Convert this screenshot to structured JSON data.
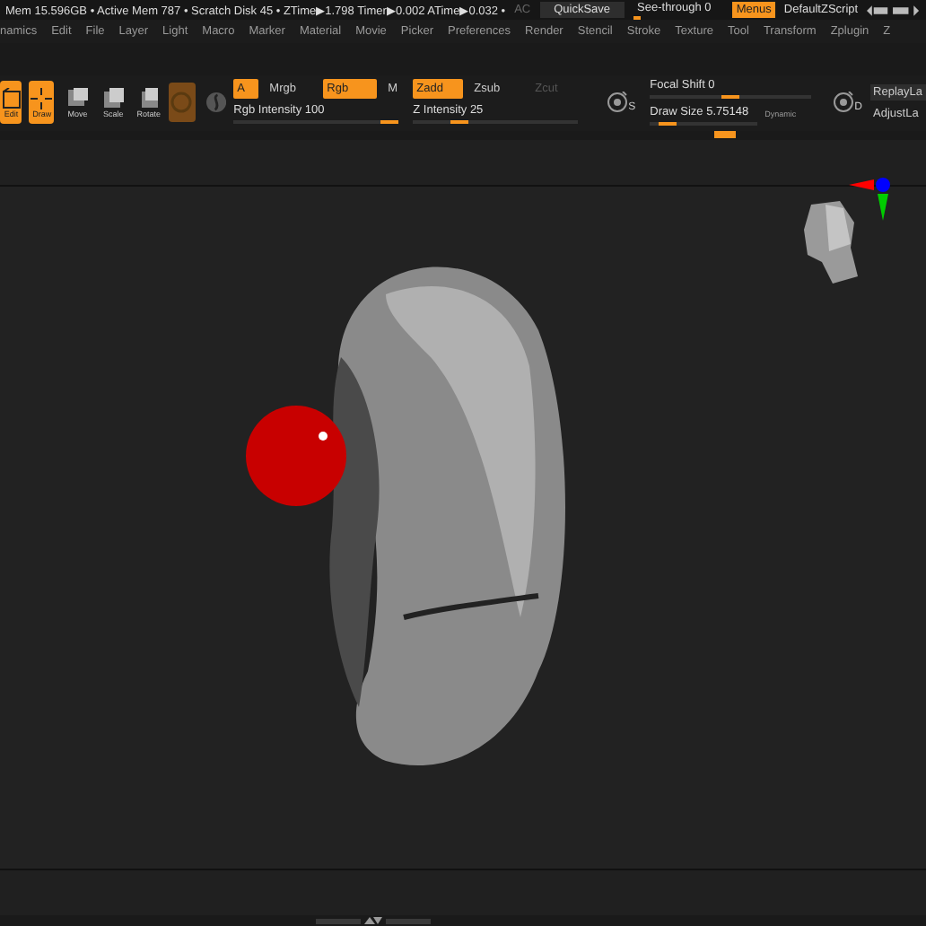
{
  "info_bar": {
    "stats": "Mem 15.596GB • Active Mem 787 • Scratch Disk 45 • ZTime▶1.798 Timer▶0.002 ATime▶0.032 •",
    "ac": "AC",
    "quicksave": "QuickSave",
    "see_through": {
      "label": "See-through  0",
      "level": 0.05
    },
    "menus": {
      "label": "Menus",
      "on": true
    },
    "script": "DefaultZScript"
  },
  "menu_bar": [
    "namics",
    "Edit",
    "File",
    "Layer",
    "Light",
    "Macro",
    "Marker",
    "Material",
    "Movie",
    "Picker",
    "Preferences",
    "Render",
    "Stencil",
    "Stroke",
    "Texture",
    "Tool",
    "Transform",
    "Zplugin",
    "Z"
  ],
  "toolbar": {
    "tools": [
      {
        "label": "Edit",
        "selected": true
      },
      {
        "label": "Draw",
        "selected": true
      },
      {
        "label": "Move",
        "selected": false
      },
      {
        "label": "Scale",
        "selected": false
      },
      {
        "label": "Rotate",
        "selected": false
      }
    ],
    "toggles": [
      {
        "label": "A",
        "selected": true
      },
      {
        "label": "Mrgb",
        "selected": false
      },
      {
        "label": "Rgb",
        "selected": true
      },
      {
        "label": "M",
        "selected": false
      },
      {
        "label": "Zadd",
        "selected": true
      },
      {
        "label": "Zsub",
        "selected": false
      },
      {
        "label": "Zcut",
        "selected": false,
        "disabled": true
      }
    ],
    "sliders": [
      {
        "label": "Rgb Intensity 100",
        "level": 1.0
      },
      {
        "label": "Z Intensity 25",
        "level": 0.25
      },
      {
        "label": "Focal Shift 0",
        "level": 0.5
      },
      {
        "label": "Draw Size 5.75148",
        "level": 0.1
      }
    ],
    "dynamic": "Dynamic",
    "s_key": "S",
    "d_key": "D",
    "right_buttons": [
      "ReplayLa",
      "AdjustLa"
    ]
  }
}
